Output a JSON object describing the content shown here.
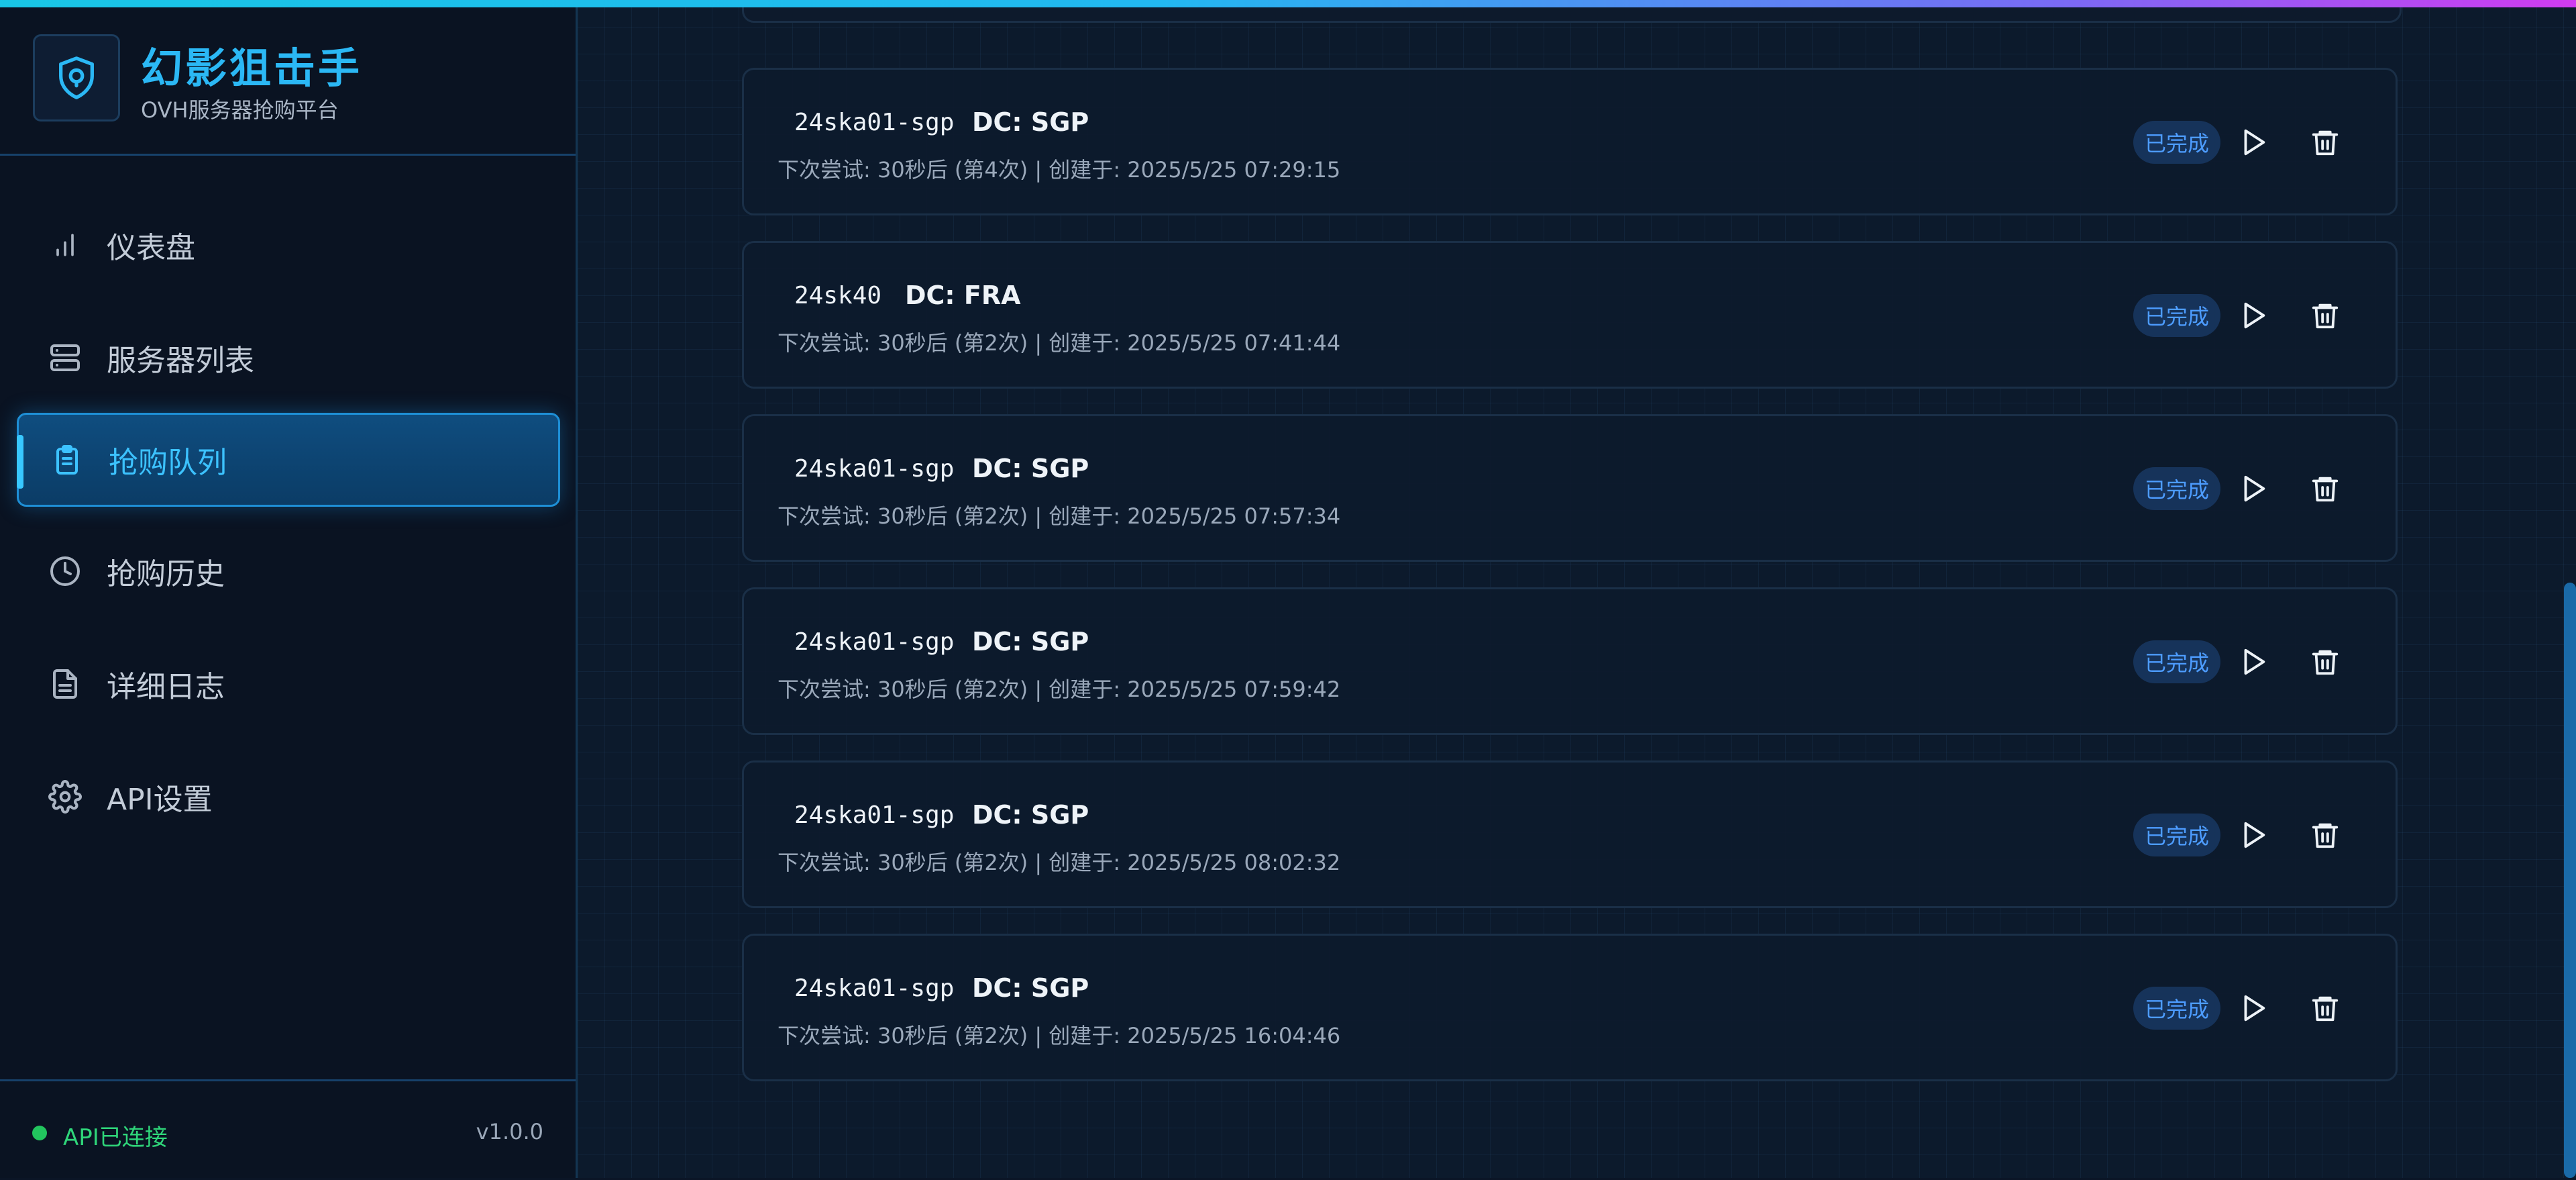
{
  "brand": {
    "title": "幻影狙击手",
    "subtitle": "OVH服务器抢购平台"
  },
  "nav": {
    "items": [
      {
        "label": "仪表盘",
        "icon": "bar-chart-icon"
      },
      {
        "label": "服务器列表",
        "icon": "server-icon"
      },
      {
        "label": "抢购队列",
        "icon": "clipboard-icon",
        "active": true
      },
      {
        "label": "抢购历史",
        "icon": "clock-icon"
      },
      {
        "label": "详细日志",
        "icon": "document-icon"
      },
      {
        "label": "API设置",
        "icon": "gear-icon"
      }
    ]
  },
  "footer": {
    "status": "API已连接",
    "version": "v1.0.0"
  },
  "queue": [
    {
      "name": "24ska01-sgp",
      "dc": "DC: SGP",
      "meta": "下次尝试: 30秒后 (第4次) | 创建于: 2025/5/25 07:29:15",
      "status": "已完成"
    },
    {
      "name": "24sk40",
      "dc": "DC: FRA",
      "meta": "下次尝试: 30秒后 (第2次) | 创建于: 2025/5/25 07:41:44",
      "status": "已完成"
    },
    {
      "name": "24ska01-sgp",
      "dc": "DC: SGP",
      "meta": "下次尝试: 30秒后 (第2次) | 创建于: 2025/5/25 07:57:34",
      "status": "已完成"
    },
    {
      "name": "24ska01-sgp",
      "dc": "DC: SGP",
      "meta": "下次尝试: 30秒后 (第2次) | 创建于: 2025/5/25 07:59:42",
      "status": "已完成"
    },
    {
      "name": "24ska01-sgp",
      "dc": "DC: SGP",
      "meta": "下次尝试: 30秒后 (第2次) | 创建于: 2025/5/25 08:02:32",
      "status": "已完成"
    },
    {
      "name": "24ska01-sgp",
      "dc": "DC: SGP",
      "meta": "下次尝试: 30秒后 (第2次) | 创建于: 2025/5/25 16:04:46",
      "status": "已完成"
    }
  ],
  "colors": {
    "accent": "#2bb8f5",
    "active_nav": "#3cc2ff",
    "status_ok": "#22c55e",
    "badge_text": "#4d9cff"
  }
}
